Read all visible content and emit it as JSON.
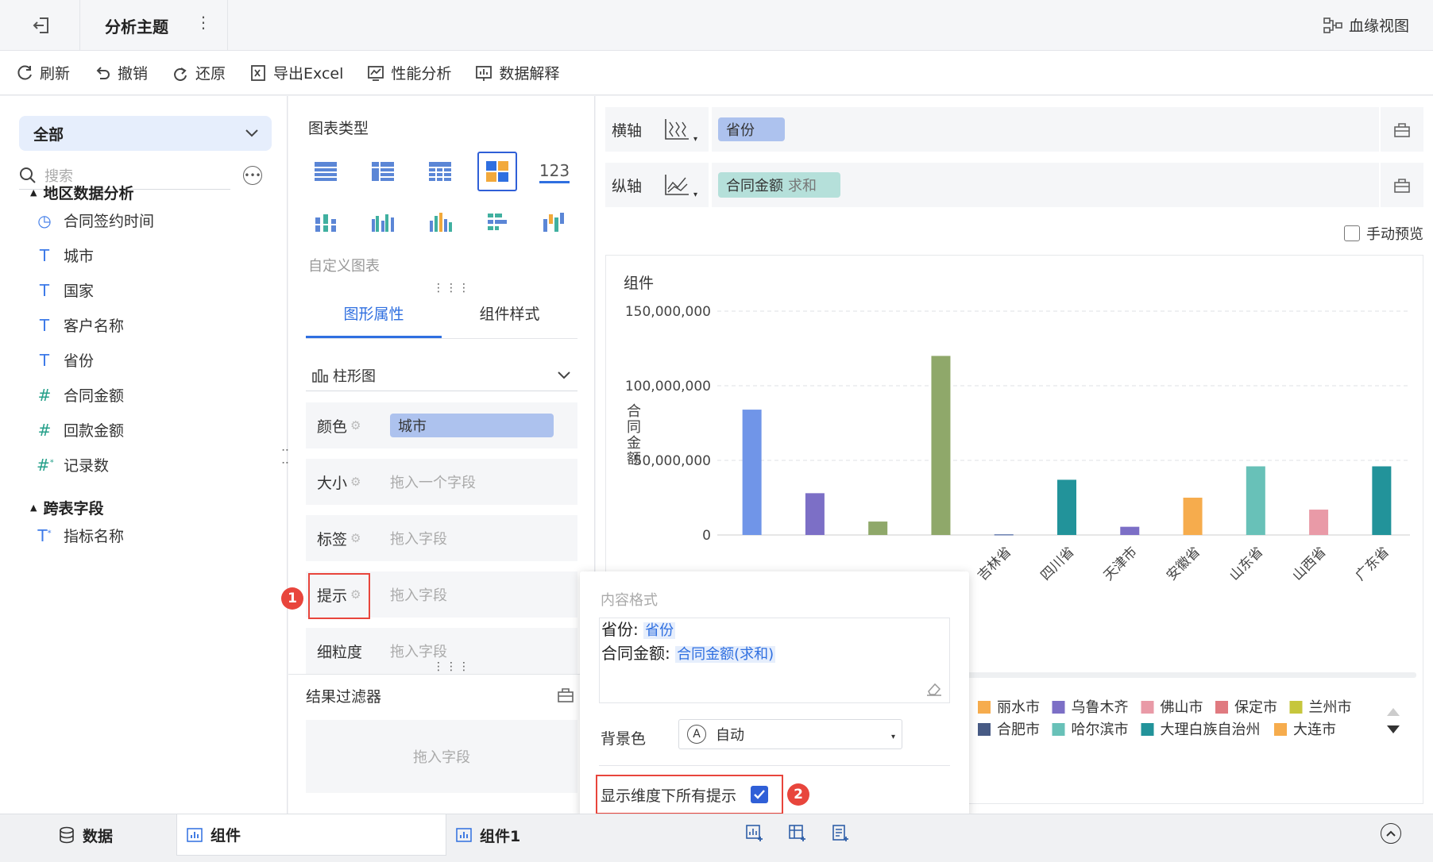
{
  "header": {
    "title": "分析主题",
    "more": "⋮",
    "lineage_label": "血缘视图"
  },
  "toolbar": {
    "refresh": "刷新",
    "undo": "撤销",
    "redo": "还原",
    "export": "导出Excel",
    "perf": "性能分析",
    "explain": "数据解释"
  },
  "left": {
    "scope": "全部",
    "search_placeholder": "搜索",
    "groups": [
      {
        "name": "地区数据分析",
        "fields": [
          {
            "type": "time",
            "label": "合同签约时间"
          },
          {
            "type": "text",
            "label": "城市"
          },
          {
            "type": "text",
            "label": "国家"
          },
          {
            "type": "text",
            "label": "客户名称"
          },
          {
            "type": "text",
            "label": "省份"
          },
          {
            "type": "number",
            "label": "合同金额"
          },
          {
            "type": "number",
            "label": "回款金额"
          },
          {
            "type": "number-calc",
            "label": "记录数"
          }
        ]
      },
      {
        "name": "跨表字段",
        "fields": [
          {
            "type": "text-calc",
            "label": "指标名称"
          }
        ]
      }
    ]
  },
  "mid": {
    "chart_type_title": "图表类型",
    "custom_chart": "自定义图表",
    "tabs": [
      "图形属性",
      "组件样式"
    ],
    "chart_kind": "柱形图",
    "props": {
      "color": {
        "label": "颜色",
        "value": "城市"
      },
      "size": {
        "label": "大小",
        "placeholder": "拖入一个字段"
      },
      "label": {
        "label": "标签",
        "placeholder": "拖入字段"
      },
      "tooltip": {
        "label": "提示",
        "placeholder": "拖入字段"
      },
      "granularity": {
        "label": "细粒度",
        "placeholder": "拖入字段"
      }
    },
    "filter_title": "结果过滤器",
    "filter_placeholder": "拖入字段",
    "badge1": "1"
  },
  "axes": {
    "x_label": "横轴",
    "x_value": "省份",
    "y_label": "纵轴",
    "y_value": "合同金额",
    "y_agg": "求和",
    "manual_preview": "手动预览"
  },
  "chart": {
    "card_title": "组件"
  },
  "chart_data": {
    "type": "bar",
    "ylabel": "合同金额",
    "ylim": [
      0,
      150000000
    ],
    "yticks": [
      "150,000,000",
      "100,000,000",
      "50,000,000",
      "0"
    ],
    "categories": [
      "吉林省",
      "四川省",
      "天津市",
      "安徽省",
      "山东省",
      "山西省",
      "广东省"
    ],
    "bars": [
      {
        "value": 84000000,
        "color": "#7095e8"
      },
      {
        "value": 28000000,
        "color": "#7c6fc6"
      },
      {
        "value": 9000000,
        "color": "#8fa86a"
      },
      {
        "value": 120000000,
        "color": "#8fa86a"
      },
      {
        "value": 500000,
        "color": "#6a7fb0"
      },
      {
        "value": 37000000,
        "color": "#22939a"
      },
      {
        "value": 5500000,
        "color": "#7c6fc6"
      },
      {
        "value": 25000000,
        "color": "#f6ac4d"
      },
      {
        "value": 46000000,
        "color": "#68c1b8"
      },
      {
        "value": 17000000,
        "color": "#e99aa7"
      },
      {
        "value": 46000000,
        "color": "#22939a"
      }
    ],
    "legend": [
      {
        "name": "丽水市",
        "color": "#f6ac4d"
      },
      {
        "name": "乌鲁木齐",
        "color": "#7c6fc6"
      },
      {
        "name": "佛山市",
        "color": "#e99aa7"
      },
      {
        "name": "保定市",
        "color": "#e07a80"
      },
      {
        "name": "兰州市",
        "color": "#c6c63c"
      },
      {
        "name": "合肥市",
        "color": "#475a84"
      },
      {
        "name": "哈尔滨市",
        "color": "#68c1b8"
      },
      {
        "name": "大理白族自治州",
        "color": "#22939a"
      },
      {
        "name": "大连市",
        "color": "#f6ac4d"
      }
    ]
  },
  "popup": {
    "title": "内容格式",
    "line1_label": "省份:",
    "line1_tag": "省份",
    "line2_label": "合同金额:",
    "line2_tag": "合同金额(求和)",
    "bg_label": "背景色",
    "bg_value": "自动",
    "show_all": "显示维度下所有提示",
    "badge2": "2"
  },
  "bottom": {
    "data": "数据",
    "tab1": "组件",
    "tab2": "组件1"
  }
}
